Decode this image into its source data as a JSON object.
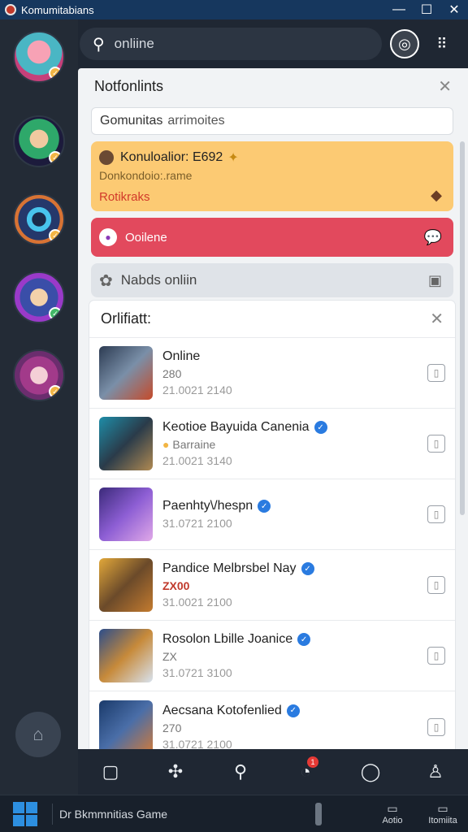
{
  "window": {
    "title": "Komumitabians",
    "minimize": "—",
    "maximize": "☐",
    "close": "✕"
  },
  "search": {
    "placeholder": "onliine",
    "value": "onliine"
  },
  "top_icons": {
    "profile": "◎",
    "menu": "⠿"
  },
  "panel": {
    "title": "Notfonlints",
    "filter_text": "Gomunitas",
    "filter_accent": "arrimoites",
    "yellow_card": {
      "title": "Konuloalior: E692",
      "subtitle": "Donkondoio:.rame",
      "label": "Rotikraks"
    },
    "red_card": {
      "label": "Ooilene"
    },
    "gray_card": {
      "label": "Nabds onliin"
    }
  },
  "subpanel": {
    "title": "Orlifiatt:",
    "items": [
      {
        "name": "Online",
        "sub": "280",
        "date": "21.0021 2140",
        "verified": false
      },
      {
        "name": "Keotioe Bayuida Canenia",
        "sub": "Barraine",
        "date": "21.0021 3140",
        "verified": true
      },
      {
        "name": "Paenhty\\/hespn",
        "sub": "",
        "date": "31.0721 2100",
        "verified": true
      },
      {
        "name": "Pandice Melbrsbel Nay",
        "sub": "ZX00",
        "date": "31.0021 2100",
        "verified": true
      },
      {
        "name": "Rosolon Lbille Joanice",
        "sub": "ZX",
        "date": "31.0721 3100",
        "verified": true
      },
      {
        "name": "Aecsana Kotofenlied",
        "sub": "270",
        "date": "31.0721 2100",
        "verified": true
      }
    ]
  },
  "bottom_nav": {
    "badge": "1"
  },
  "taskbar": {
    "title": "Dr Bkmmnitias Game",
    "item1": "Aotio",
    "item2": "Itomiita"
  },
  "colors": {
    "titlebar": "#16375e",
    "accent_yellow": "#fcca73",
    "accent_red": "#e2495d",
    "verify": "#2a7be0"
  }
}
